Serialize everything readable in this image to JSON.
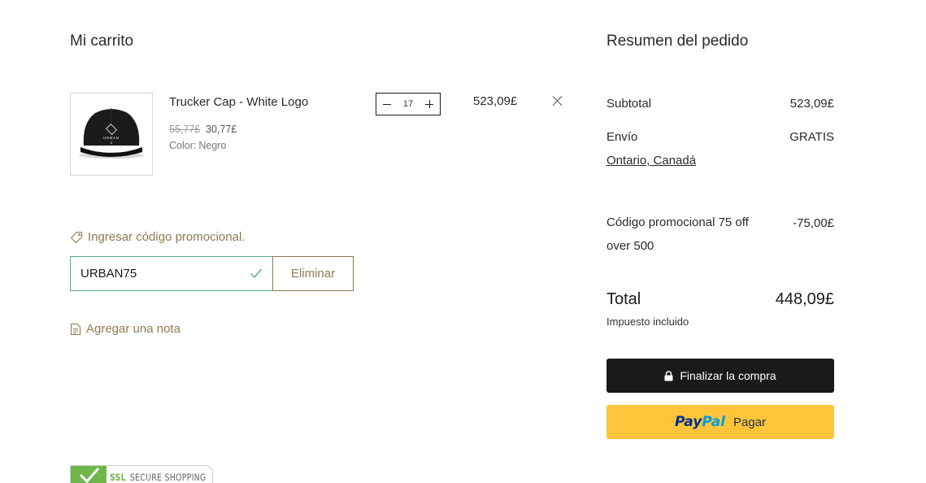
{
  "cart": {
    "title": "Mi carrito",
    "item": {
      "name": "Trucker Cap - White Logo",
      "price_original": "55,77£",
      "price_sale": "30,77£",
      "variant_label": "Color:",
      "variant_value": "Negro",
      "quantity": "17",
      "line_total": "523,09£",
      "logo_text": "URBAN",
      "logo_subtext": "G"
    },
    "promo": {
      "link_label": "Ingresar código promocional.",
      "code_value": "URBAN75",
      "remove_label": "Eliminar"
    },
    "note_label": "Agregar una nota",
    "ssl_badge": {
      "ssl": "SSL",
      "text": "SECURE SHOPPING"
    }
  },
  "summary": {
    "title": "Resumen del pedido",
    "subtotal_label": "Subtotal",
    "subtotal_value": "523,09£",
    "shipping_label": "Envío",
    "shipping_value": "GRATIS",
    "shipping_location": "Ontario, Canadá",
    "promo_label": "Código promocional 75 off over 500",
    "promo_value": "-75,00£",
    "total_label": "Total",
    "total_value": "448,09£",
    "tax_note": "Impuesto incluido",
    "checkout_label": "Finalizar la compra",
    "paypal_brand_1": "Pay",
    "paypal_brand_2": "Pal",
    "paypal_label": "Pagar"
  },
  "colors": {
    "accent_link": "#8f7a55",
    "valid_border": "#5aaa7d",
    "checkout_bg": "#1a1a1a",
    "paypal_bg": "#ffc439",
    "ssl_green": "#6fb74a"
  }
}
